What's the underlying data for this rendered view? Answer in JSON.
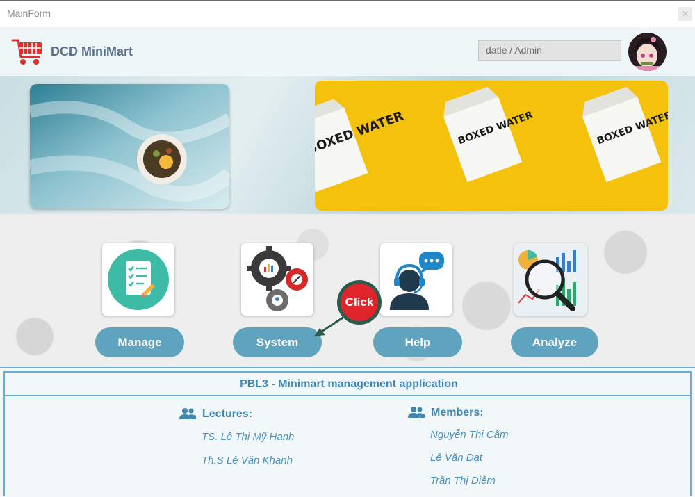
{
  "window": {
    "title": "MainForm",
    "close_glyph": "✕"
  },
  "header": {
    "app_name": "DCD MiniMart",
    "user_field_value": "datle / Admin",
    "logo_icon": "shopping-cart-icon"
  },
  "banner": {
    "box_labels": [
      "BOXED WATER",
      "BOXED WATER",
      "BOXED WATER"
    ]
  },
  "menu": {
    "buttons": [
      {
        "label": "Manage",
        "icon": "clipboard-checklist-icon"
      },
      {
        "label": "System",
        "icon": "gears-icon"
      },
      {
        "label": "Help",
        "icon": "support-agent-icon"
      },
      {
        "label": "Analyze",
        "icon": "analytics-magnifier-icon"
      }
    ],
    "click_hint": "Click"
  },
  "info": {
    "title": "PBL3 - Minimart management application",
    "lectures_label": "Lectures:",
    "lectures": [
      "TS. Lê Thị Mỹ Hạnh",
      "Th.S Lê Văn Khanh"
    ],
    "members_label": "Members:",
    "members": [
      "Nguyễn Thị Cầm",
      "Lê Văn Đạt",
      "Trần Thị Diễm"
    ]
  },
  "colors": {
    "accent": "#5fa3be",
    "title_text": "#3f87b1",
    "click_red": "#e0242c",
    "banner_yellow": "#f4c20d"
  }
}
